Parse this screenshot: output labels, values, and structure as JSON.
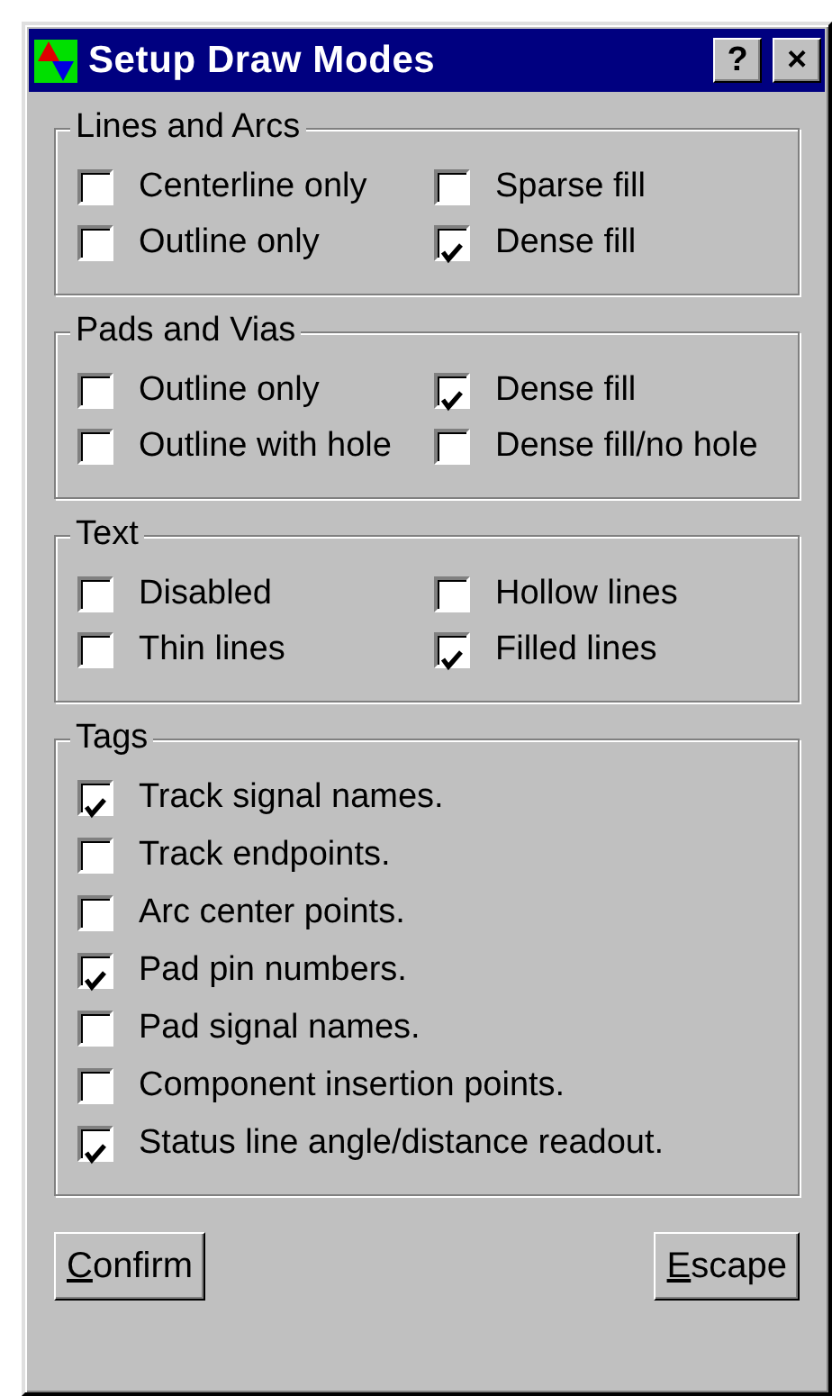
{
  "window": {
    "title": "Setup Draw Modes",
    "title_buttons": [
      "?",
      "×"
    ]
  },
  "groups": [
    {
      "title": "Lines and Arcs",
      "kind": "grid",
      "items": [
        {
          "label": "Centerline only",
          "checked": false
        },
        {
          "label": "Sparse fill",
          "checked": false
        },
        {
          "label": "Outline only",
          "checked": false
        },
        {
          "label": "Dense fill",
          "checked": true
        }
      ]
    },
    {
      "title": "Pads and Vias",
      "kind": "grid",
      "items": [
        {
          "label": "Outline only",
          "checked": false
        },
        {
          "label": "Dense fill",
          "checked": true
        },
        {
          "label": "Outline with hole",
          "checked": false
        },
        {
          "label": "Dense fill/no hole",
          "checked": false
        }
      ]
    },
    {
      "title": "Text",
      "kind": "grid",
      "items": [
        {
          "label": "Disabled",
          "checked": false
        },
        {
          "label": "Hollow lines",
          "checked": false
        },
        {
          "label": "Thin lines",
          "checked": false
        },
        {
          "label": "Filled lines",
          "checked": true
        }
      ]
    },
    {
      "title": "Tags",
      "kind": "list",
      "items": [
        {
          "label": "Track signal names.",
          "checked": true
        },
        {
          "label": "Track endpoints.",
          "checked": false
        },
        {
          "label": "Arc center points.",
          "checked": false
        },
        {
          "label": "Pad pin numbers.",
          "checked": true
        },
        {
          "label": "Pad signal names.",
          "checked": false
        },
        {
          "label": "Component insertion points.",
          "checked": false
        },
        {
          "label": "Status line angle/distance readout.",
          "checked": true
        }
      ]
    }
  ],
  "buttons": [
    {
      "label": "Confirm",
      "underline_first": true
    },
    {
      "label": "Escape",
      "underline_first": true
    }
  ]
}
